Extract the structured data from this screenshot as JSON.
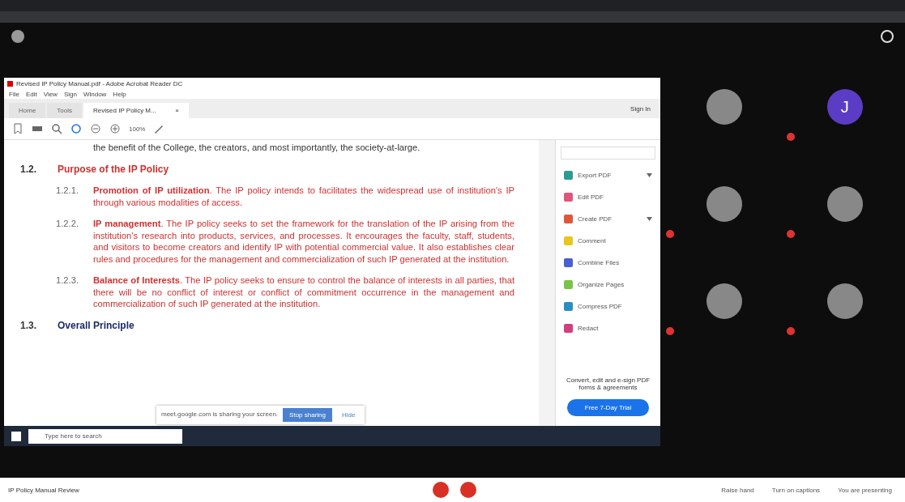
{
  "acrobat": {
    "title": "Revised IP Policy Manual.pdf - Adobe Acrobat Reader DC",
    "menu": [
      "File",
      "Edit",
      "View",
      "Sign",
      "Window",
      "Help"
    ],
    "tabs": [
      {
        "label": "Home",
        "selected": false
      },
      {
        "label": "Tools",
        "selected": false
      },
      {
        "label": "Revised IP Policy M...",
        "selected": true,
        "close": "×"
      }
    ],
    "sign_in": "Sign In",
    "zoom": "100%",
    "document": {
      "intro": "the benefit of the College, the creators, and most importantly, the society-at-large.",
      "sections": [
        {
          "number": "1.2.",
          "title": "Purpose of the IP Policy",
          "items": [
            {
              "number": "1.2.1.",
              "text": "**Promotion of IP utilization**. The IP policy intends to facilitates the widespread use of institution's IP through various modalities of access."
            },
            {
              "number": "1.2.2.",
              "text": "**IP management**. The IP policy seeks to set the framework for the translation of the IP arising from the institution's research into products, services, and processes. It encourages the faculty, staff, students, and visitors to become creators and identify IP with potential commercial value. It also establishes clear rules and procedures for the management and commercialization of such IP generated at the institution."
            },
            {
              "number": "1.2.3.",
              "text": "**Balance of Interests**. The IP policy seeks to ensure to control the balance of interests in all parties, that there will be no conflict of interest or conflict of commitment occurrence in the management and commercialization of such IP generated at the institution."
            }
          ]
        },
        {
          "number": "1.3.",
          "title": "Overall Principle"
        }
      ]
    },
    "share_banner": {
      "text": "meet.google.com is sharing your screen.",
      "stop": "Stop sharing",
      "hide": "Hide"
    },
    "tools": [
      {
        "label": "Export PDF",
        "color": "#2a9d8f",
        "expandable": true
      },
      {
        "label": "Edit PDF",
        "color": "#e0567a",
        "expandable": false
      },
      {
        "label": "Create PDF",
        "color": "#e0563a",
        "expandable": true
      },
      {
        "label": "Comment",
        "color": "#e8c520",
        "expandable": false
      },
      {
        "label": "Combine Files",
        "color": "#4a5fd0",
        "expandable": false
      },
      {
        "label": "Organize Pages",
        "color": "#7cc24a",
        "expandable": false
      },
      {
        "label": "Compress PDF",
        "color": "#2a8fc0",
        "expandable": false
      },
      {
        "label": "Redact",
        "color": "#d0407a",
        "expandable": false
      }
    ],
    "promo": "Convert, edit and e-sign PDF forms & agreements",
    "trial": "Free 7-Day Trial",
    "taskbar_search": "Type here to search"
  },
  "participants": [
    {
      "kind": "photo",
      "mic_off": false
    },
    {
      "kind": "letter",
      "letter": "J",
      "mic_off": true
    },
    {
      "kind": "photo",
      "mic_off": true
    },
    {
      "kind": "photo",
      "mic_off": true
    },
    {
      "kind": "photo",
      "mic_off": true
    },
    {
      "kind": "photo",
      "mic_off": true
    }
  ],
  "bottom_bar": {
    "meeting": "IP Policy Manual Review",
    "actions": [
      "Raise hand",
      "Turn on captions",
      "You are presenting"
    ]
  }
}
